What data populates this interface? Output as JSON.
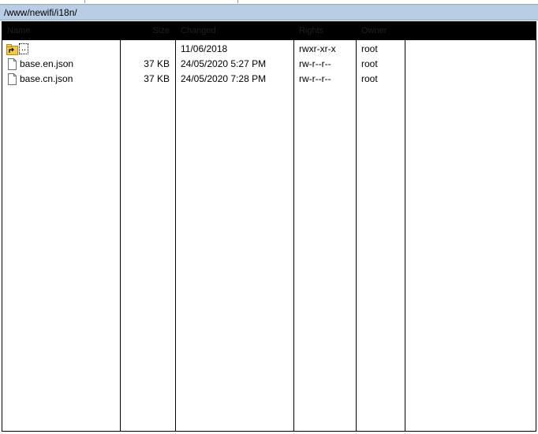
{
  "path_bar": {
    "path": "/www/newifi/i18n/"
  },
  "columns": {
    "name": "Name",
    "size": "Size",
    "changed": "Changed",
    "rights": "Rights",
    "owner": "Owner"
  },
  "rows": [
    {
      "name": "..",
      "icon": "parent-folder-icon",
      "size": "",
      "changed": "11/06/2018",
      "rights": "rwxr-xr-x",
      "owner": "root"
    },
    {
      "name": "base.en.json",
      "icon": "file-icon",
      "size": "37 KB",
      "changed": "24/05/2020 5:27 PM",
      "rights": "rw-r--r--",
      "owner": "root"
    },
    {
      "name": "base.cn.json",
      "icon": "file-icon",
      "size": "37 KB",
      "changed": "24/05/2020 7:28 PM",
      "rights": "rw-r--r--",
      "owner": "root"
    }
  ],
  "colors": {
    "path_bar_bg": "#b9cde5",
    "header_bg": "#000000",
    "folder_icon": "#f2c94c"
  }
}
